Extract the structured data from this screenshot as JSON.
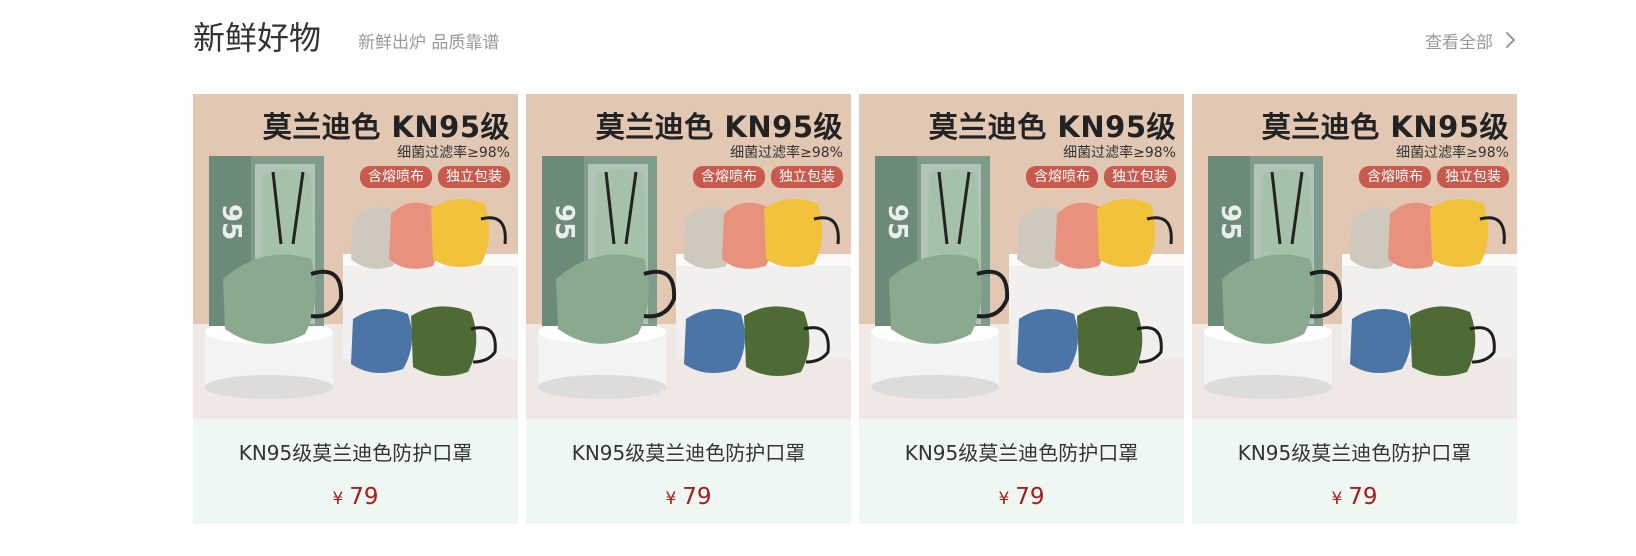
{
  "section": {
    "title": "新鲜好物",
    "subtitle": "新鲜出炉 品质靠谱",
    "view_all": "查看全部",
    "view_all_icon": "chevron-right-icon"
  },
  "products": [
    {
      "name": "KN95级莫兰迪色防护口罩",
      "currency": "¥",
      "price": "79",
      "image": {
        "headline": "莫兰迪色 KN95级",
        "subline": "细菌过滤率≥98%",
        "badges": [
          "含熔喷布",
          "独立包装"
        ],
        "box_label": "95"
      }
    },
    {
      "name": "KN95级莫兰迪色防护口罩",
      "currency": "¥",
      "price": "79",
      "image": {
        "headline": "莫兰迪色 KN95级",
        "subline": "细菌过滤率≥98%",
        "badges": [
          "含熔喷布",
          "独立包装"
        ],
        "box_label": "95"
      }
    },
    {
      "name": "KN95级莫兰迪色防护口罩",
      "currency": "¥",
      "price": "79",
      "image": {
        "headline": "莫兰迪色 KN95级",
        "subline": "细菌过滤率≥98%",
        "badges": [
          "含熔喷布",
          "独立包装"
        ],
        "box_label": "95"
      }
    },
    {
      "name": "KN95级莫兰迪色防护口罩",
      "currency": "¥",
      "price": "79",
      "image": {
        "headline": "莫兰迪色 KN95级",
        "subline": "细菌过滤率≥98%",
        "badges": [
          "含熔喷布",
          "独立包装"
        ],
        "box_label": "95"
      }
    }
  ],
  "colors": {
    "card_background": "#eef7f2",
    "price": "#a81c1c",
    "badge": "#c75a4c",
    "muted_text": "#999999",
    "title_text": "#333333"
  }
}
